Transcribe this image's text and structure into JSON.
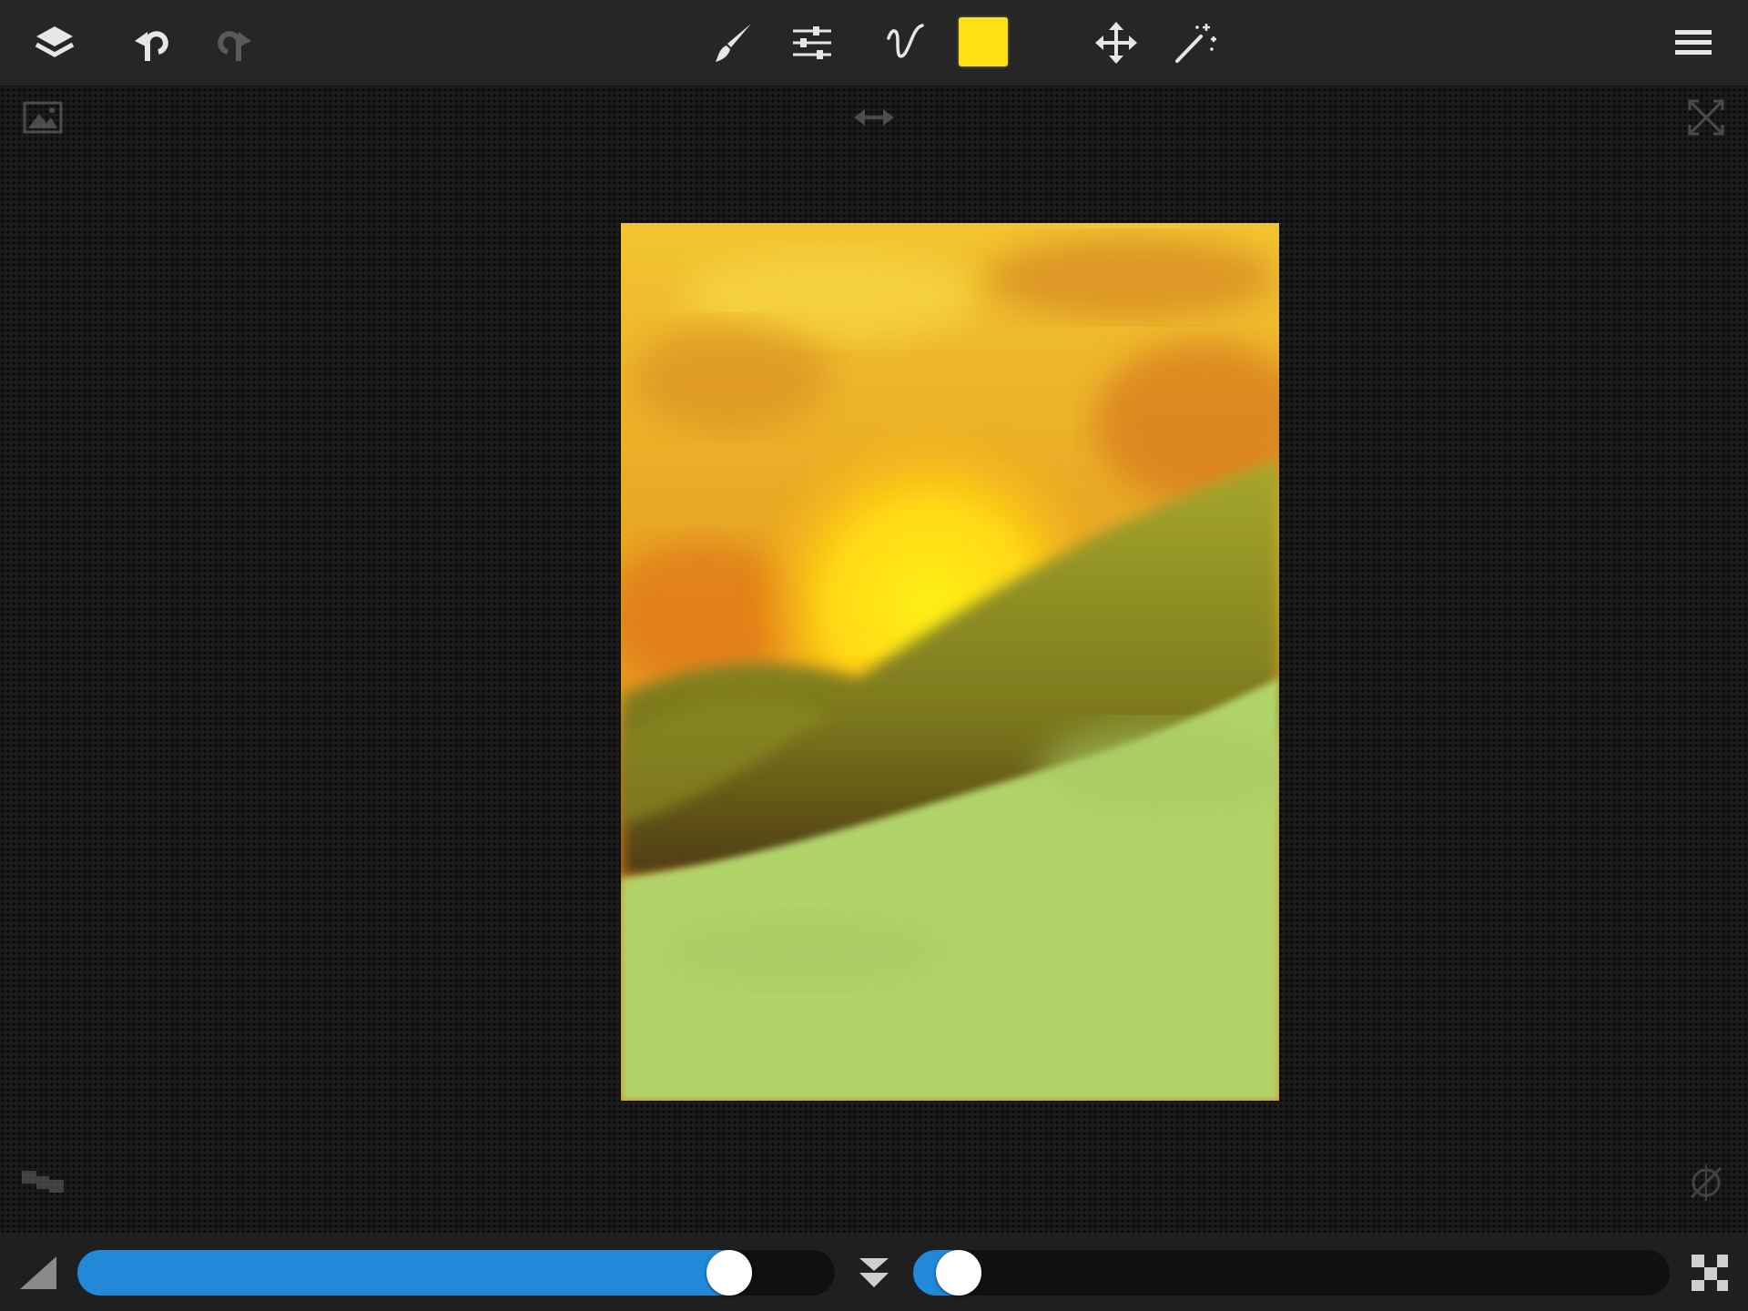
{
  "toolbar": {
    "icons": [
      "layers-icon",
      "undo-icon",
      "redo-icon",
      "brush-icon",
      "brush-settings-icon",
      "stroke-icon",
      "move-icon",
      "magic-wand-icon",
      "menu-icon"
    ],
    "current_color": "#ffe014",
    "redo_enabled": false
  },
  "corners": {
    "top_left": "reference-image-icon",
    "top_center": "flip-horizontal-icon",
    "top_right": "fullscreen-icon",
    "bottom_left": "gallery-icon",
    "bottom_right": "symmetry-icon"
  },
  "bottombar": {
    "brush_size_fraction": 0.86,
    "opacity_fraction": 0.06,
    "accent_color": "#2288d8"
  },
  "colors": {
    "toolbar_bg": "#262626",
    "icon": "#e6e6e6",
    "icon_disabled": "#5a5a5a"
  }
}
